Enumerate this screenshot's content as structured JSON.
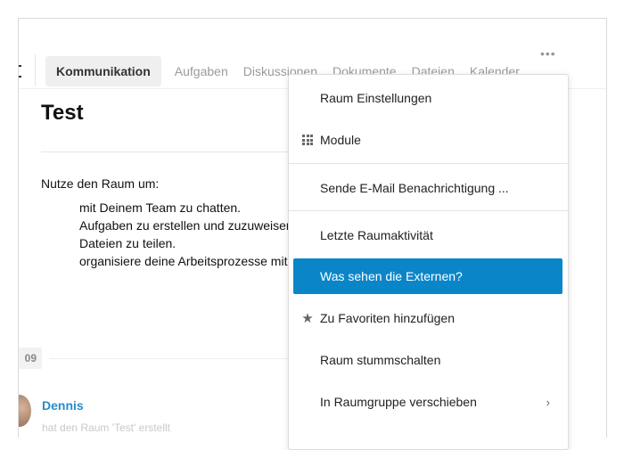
{
  "tabs": [
    {
      "label": "Kommunikation",
      "active": true
    },
    {
      "label": "Aufgaben"
    },
    {
      "label": "Diskussionen"
    },
    {
      "label": "Dokumente"
    },
    {
      "label": "Dateien"
    },
    {
      "label": "Kalender"
    }
  ],
  "more_label": "•••",
  "room": {
    "title": "Test",
    "intro": "Nutze den Raum um:",
    "bullets": [
      "mit Deinem Team zu chatten.",
      "Aufgaben zu erstellen und zuzuweisen.",
      "Dateien zu teilen.",
      "organisiere deine Arbeitsprozesse mit"
    ]
  },
  "timeline": {
    "date_chip": "09",
    "author": "Dennis",
    "activity": "hat den Raum 'Test' erstellt"
  },
  "menu": {
    "items": [
      {
        "label": "Raum Einstellungen"
      },
      {
        "label": "Module",
        "icon": "grid-icon"
      },
      {
        "label": "Sende E-Mail Benachrichtigung ..."
      },
      {
        "label": "Letzte Raumaktivität"
      },
      {
        "label": "Was sehen die Externen?",
        "highlighted": true
      },
      {
        "label": "Zu Favoriten hinzufügen",
        "icon": "star-icon"
      },
      {
        "label": "Raum stummschalten"
      },
      {
        "label": "In Raumgruppe verschieben",
        "icon": "chevron-right-icon"
      }
    ],
    "chevron": "›",
    "star": "★"
  },
  "colors": {
    "accent": "#0a86c8",
    "author_link": "#2a8cc6",
    "tab_inactive": "#9a9a9a"
  }
}
